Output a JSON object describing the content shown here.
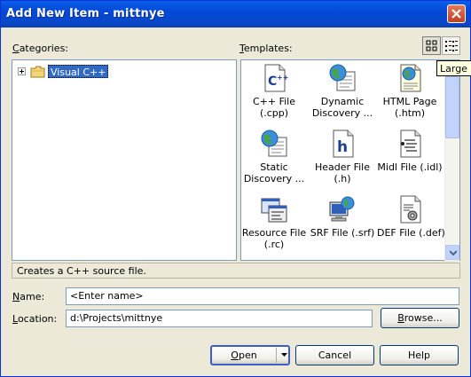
{
  "window": {
    "title": "Add New Item - mittnye"
  },
  "categories": {
    "label_mnemonic": "C",
    "label_rest": "ategories:",
    "tree": [
      {
        "label": "Visual C++",
        "selected": true
      }
    ]
  },
  "templates": {
    "label_mnemonic": "T",
    "label_rest": "emplates:",
    "tooltip": "Large Icons",
    "items": [
      {
        "line1": "C++ File",
        "line2": "(.cpp)",
        "icon": "cpp-file-icon",
        "selected": true
      },
      {
        "line1": "Dynamic",
        "line2": "Discovery ...",
        "icon": "dynamic-discovery-icon"
      },
      {
        "line1": "HTML Page",
        "line2": "(.htm)",
        "icon": "html-page-icon"
      },
      {
        "line1": "Static",
        "line2": "Discovery ...",
        "icon": "static-discovery-icon"
      },
      {
        "line1": "Header File",
        "line2": "(.h)",
        "icon": "header-file-icon"
      },
      {
        "line1": "Midl File (.idl)",
        "line2": "",
        "icon": "midl-file-icon"
      },
      {
        "line1": "Resource File",
        "line2": "(.rc)",
        "icon": "resource-file-icon"
      },
      {
        "line1": "SRF File (.srf)",
        "line2": "",
        "icon": "srf-file-icon"
      },
      {
        "line1": "DEF File (.def)",
        "line2": "",
        "icon": "def-file-icon"
      }
    ]
  },
  "description": "Creates a C++ source file.",
  "name": {
    "label_mnemonic": "N",
    "label_rest": "ame:",
    "value": "<Enter name>"
  },
  "location": {
    "label_mnemonic": "L",
    "label_rest": "ocation:",
    "value": "d:\\Projects\\mittnye"
  },
  "buttons": {
    "browse_mnemonic": "B",
    "browse_rest": "rowse...",
    "open_mnemonic": "O",
    "open_rest": "pen",
    "cancel": "Cancel",
    "help": "Help"
  },
  "colors": {
    "titlebar": "#0a5fe8",
    "selection": "#316ac5",
    "face": "#ece9d8"
  }
}
